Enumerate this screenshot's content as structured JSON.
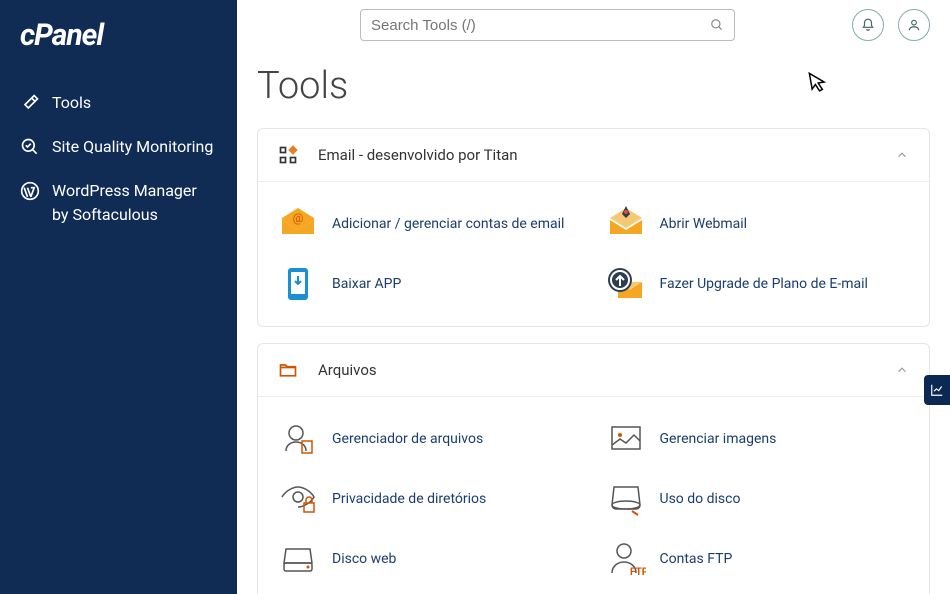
{
  "brand": "cPanel",
  "sidebar": {
    "items": [
      {
        "label": "Tools",
        "icon": "wrench"
      },
      {
        "label": "Site Quality Monitoring",
        "icon": "magnifier-check"
      },
      {
        "label": "WordPress Manager by Softaculous",
        "icon": "wordpress"
      }
    ]
  },
  "header": {
    "search_placeholder": "Search Tools (/)"
  },
  "page_title": "Tools",
  "sections": [
    {
      "title": "Email - desenvolvido por Titan",
      "icon": "grid-dots",
      "items": [
        {
          "label": "Adicionar / gerenciar contas de email",
          "icon": "envelope-at"
        },
        {
          "label": "Abrir Webmail",
          "icon": "envelope-rocket"
        },
        {
          "label": "Baixar APP",
          "icon": "phone-download"
        },
        {
          "label": "Fazer Upgrade de Plano de E-mail",
          "icon": "envelope-upgrade"
        }
      ]
    },
    {
      "title": "Arquivos",
      "icon": "folder",
      "items": [
        {
          "label": "Gerenciador de arquivos",
          "icon": "file-user"
        },
        {
          "label": "Gerenciar imagens",
          "icon": "image"
        },
        {
          "label": "Privacidade de diretórios",
          "icon": "eye-lock"
        },
        {
          "label": "Uso do disco",
          "icon": "disk"
        },
        {
          "label": "Disco web",
          "icon": "drive"
        },
        {
          "label": "Contas FTP",
          "icon": "ftp-user"
        }
      ]
    }
  ]
}
